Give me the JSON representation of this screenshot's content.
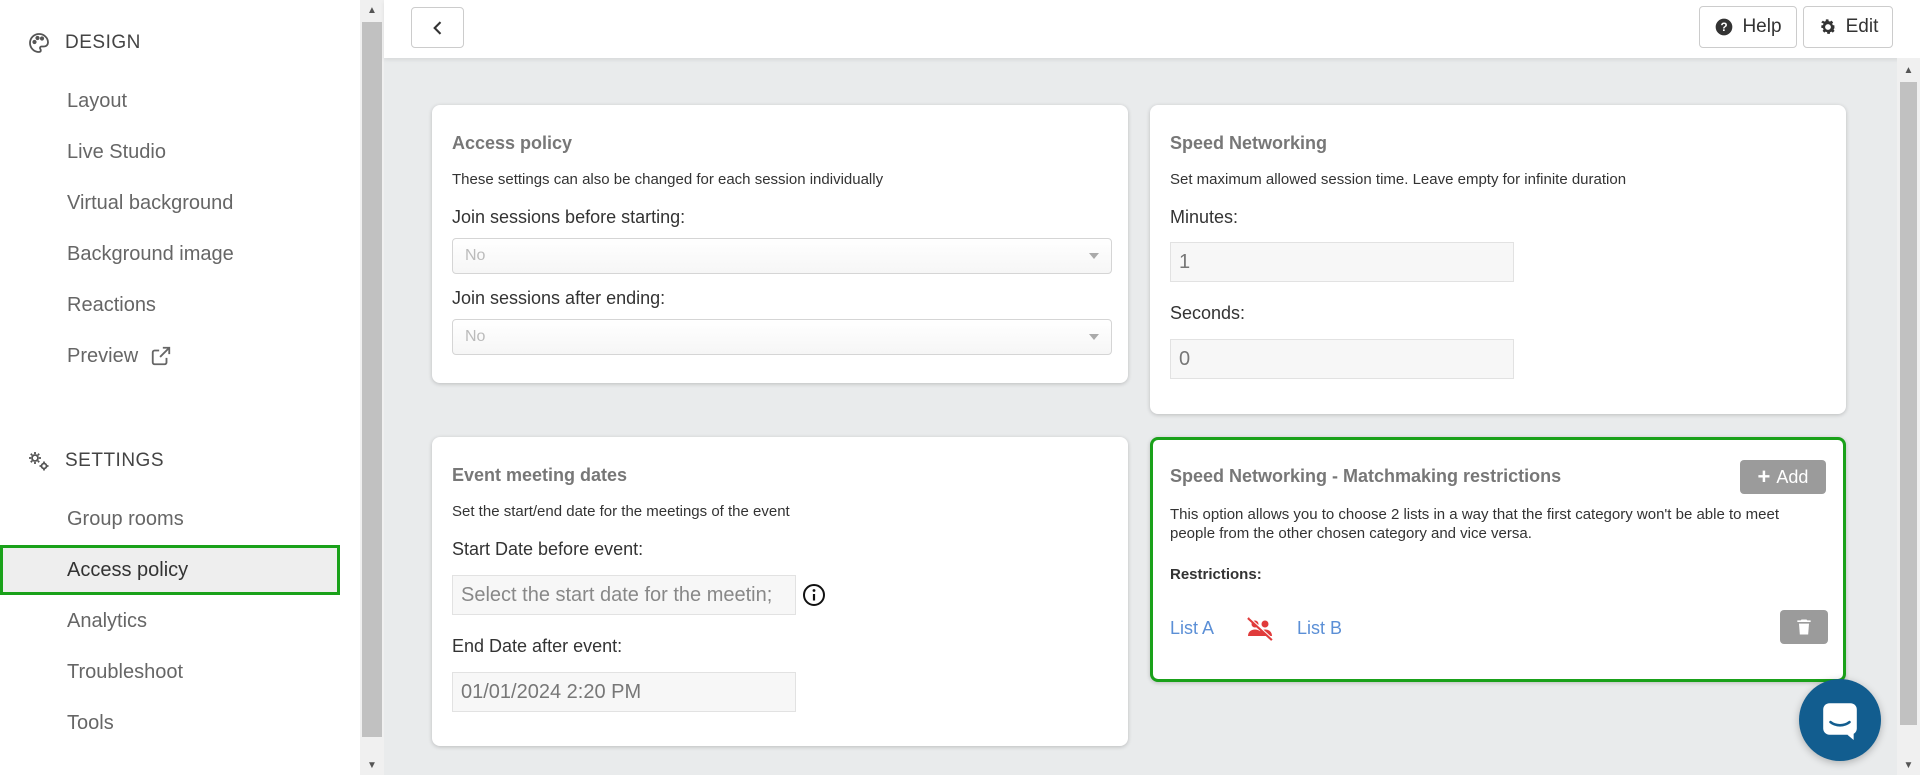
{
  "sidebar": {
    "design_heading": "DESIGN",
    "design_items": [
      "Layout",
      "Live Studio",
      "Virtual background",
      "Background image",
      "Reactions",
      "Preview"
    ],
    "settings_heading": "SETTINGS",
    "settings_items": [
      "Group rooms",
      "Access policy",
      "Analytics",
      "Troubleshoot",
      "Tools"
    ],
    "active_item": "Access policy"
  },
  "topbar": {
    "help_label": "Help",
    "edit_label": "Edit"
  },
  "access_policy": {
    "title": "Access policy",
    "description": "These settings can also be changed for each session individually",
    "join_before_label": "Join sessions before starting:",
    "join_before_value": "No",
    "join_after_label": "Join sessions after ending:",
    "join_after_value": "No"
  },
  "speed_networking": {
    "title": "Speed Networking",
    "description": "Set maximum allowed session time. Leave empty for infinite duration",
    "minutes_label": "Minutes:",
    "minutes_value": "1",
    "seconds_label": "Seconds:",
    "seconds_value": "0"
  },
  "event_meeting_dates": {
    "title": "Event meeting dates",
    "description": "Set the start/end date for the meetings of the event",
    "start_label": "Start Date before event:",
    "start_placeholder": "Select the start date for the meetin;",
    "end_label": "End Date after event:",
    "end_value": "01/01/2024 2:20 PM"
  },
  "matchmaking": {
    "title": "Speed Networking - Matchmaking restrictions",
    "add_label": "Add",
    "description_line1": "This option allows you to choose 2 lists in a way that the first category won't be able to meet",
    "description_line2": "people from the other chosen category and vice versa.",
    "restrictions_label": "Restrictions:",
    "list_a": "List A",
    "list_b": "List B"
  },
  "colors": {
    "highlight": "#1aa11a",
    "link": "#5b8fd6",
    "chat_fab": "#125d8f",
    "restriction_icon": "#e03b3b"
  }
}
